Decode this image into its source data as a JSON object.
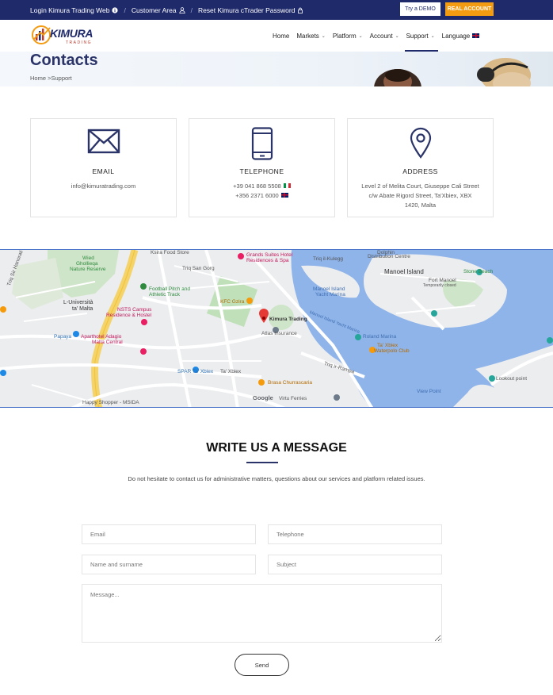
{
  "topbar": {
    "login_label": "Login Kimura Trading Web",
    "customer_label": "Customer Area",
    "reset_label": "Reset Kimura cTrader Password",
    "demo_label": "Try a DEMO",
    "real_label": "REAL ACCOUNT"
  },
  "nav": {
    "logo_text": "KIMURA",
    "logo_sub": "TRADING",
    "items": [
      {
        "label": "Home"
      },
      {
        "label": "Markets"
      },
      {
        "label": "Platform"
      },
      {
        "label": "Account"
      },
      {
        "label": "Support"
      },
      {
        "label": "Language"
      }
    ]
  },
  "hero": {
    "title": "Contacts",
    "crumb_home": "Home",
    "crumb_sep": ">",
    "crumb_current": "Support"
  },
  "cards": {
    "email": {
      "title": "EMAIL",
      "text": "info@kimuratrading.com"
    },
    "telephone": {
      "title": "TELEPHONE",
      "phone_it": "+39 041 868 5508",
      "phone_uk": "+356 2371 6000"
    },
    "address": {
      "title": "ADDRESS",
      "line1": "Level 2 of Melita Court, Giuseppe Cali Street",
      "line2": "c/w Abate Rigord Street, Ta'Xbiex, XBX",
      "line3": "1420, Malta"
    }
  },
  "map": {
    "labels": {
      "wied": "Wied",
      "ghollieqa": "Ghollieqa",
      "nature_reserve": "Nature Reserve",
      "universita1": "L-Università",
      "universita2": "ta' Malta",
      "football1": "Football Pitch and",
      "football2": "Athletic Track",
      "nsts1": "NSTS Campus",
      "nsts2": "Residence & Hostel",
      "aparthotel1": "Aparthotel Adagio",
      "aparthotel2": "Malta Central",
      "papaya": "Papaya",
      "grands1": "Grands Suites Hotel",
      "grands2": "Residences & Spa",
      "kfc": "KFC Gzira",
      "kimura": "Kimura Trading",
      "atlas": "Atlas Insurance",
      "spar": "SPAR Ta' Xbiex",
      "brasa": "Brasa Churrascaria",
      "virtu": "Virtu Ferries",
      "happy": "Happy Shopper - MSIDA",
      "manoel_island": "Manoel Island",
      "manoel_marina1": "Manoel Island",
      "manoel_marina2": "Yacht Marina",
      "manoel_yacht_marina": "Manoel Island Yacht Marina",
      "roland": "Roland Marina",
      "taxbiex_club1": "Ta' Xbiex",
      "taxbiex_club2": "Waterpolo Club",
      "fort_manoel": "Fort Manoel",
      "fort_manoel_sub": "Temporarily closed",
      "stone_beach": "Stone Beach",
      "view_point": "View Point",
      "lookout": "Lookout point",
      "distribution1": "Dolphin",
      "distribution2": "Distribution Centre",
      "kfood": "Ksira Food Store",
      "google": "Google",
      "triq_sir": "Triq Sir Hanorati",
      "triq_gorg": "Triq San Gorg",
      "triq_kulegg": "Triq il-Kulegg",
      "xbiex": "Ta' Xbiex",
      "spencer": "Triq ir-Rampa"
    }
  },
  "message": {
    "title": "WRITE US A MESSAGE",
    "text": "Do not hesitate to contact us for administrative matters, questions about our services and platform related issues.",
    "email_ph": "Email",
    "telephone_ph": "Telephone",
    "name_ph": "Name and surname",
    "subject_ph": "Subject",
    "message_ph": "Message...",
    "send_label": "Send"
  }
}
